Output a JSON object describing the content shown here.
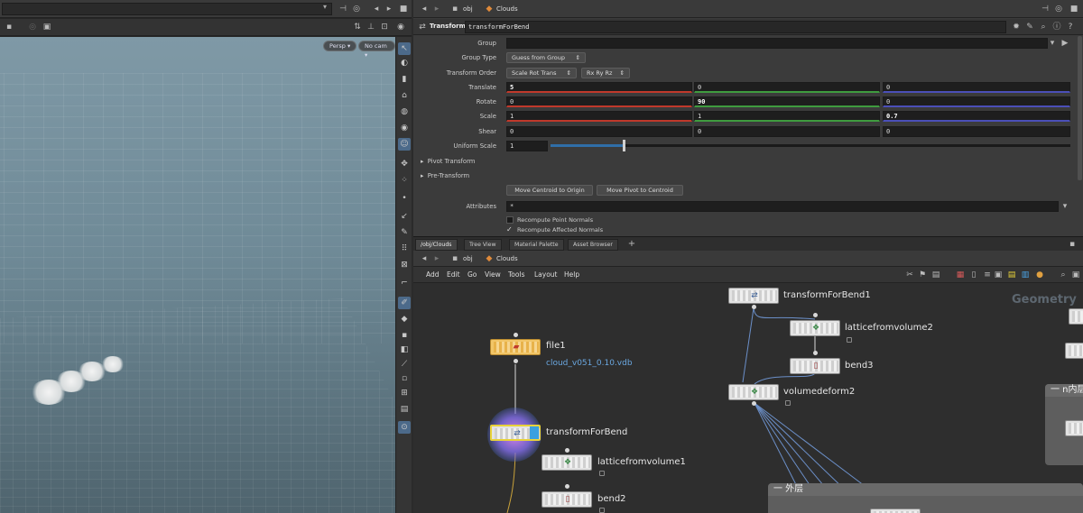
{
  "viewport": {
    "persp_label": "Persp",
    "camera_label": "No cam"
  },
  "params": {
    "path": {
      "obj": "obj",
      "network": "Clouds"
    },
    "node_type": "Transform",
    "node_name": "transformForBend",
    "rows": {
      "group": {
        "label": "Group",
        "value": ""
      },
      "group_type": {
        "label": "Group Type",
        "value": "Guess from Group"
      },
      "transform_order": {
        "label": "Transform Order",
        "value1": "Scale Rot Trans",
        "value2": "Rx Ry Rz"
      },
      "translate": {
        "label": "Translate",
        "x": "5",
        "y": "0",
        "z": "0"
      },
      "rotate": {
        "label": "Rotate",
        "x": "0",
        "y": "90",
        "z": "0"
      },
      "scale": {
        "label": "Scale",
        "x": "1",
        "y": "1",
        "z": "0.7"
      },
      "shear": {
        "label": "Shear",
        "x": "0",
        "y": "0",
        "z": "0"
      },
      "uniform_scale": {
        "label": "Uniform Scale",
        "value": "1",
        "slider_fraction": 0.14
      }
    },
    "folders": {
      "pivot": "Pivot Transform",
      "pre": "Pre-Transform"
    },
    "buttons": {
      "centroid_origin": "Move Centroid to Origin",
      "pivot_centroid": "Move Pivot to Centroid"
    },
    "attributes": {
      "label": "Attributes",
      "value": "*"
    },
    "checkboxes": {
      "recompute_normals": "Recompute Point Normals",
      "recompute_affected": "Recompute Affected Normals"
    }
  },
  "network": {
    "tabs": [
      "/obj/Clouds",
      "Tree View",
      "Material Palette",
      "Asset Browser"
    ],
    "add_tab": "+",
    "path": {
      "obj": "obj",
      "network": "Clouds"
    },
    "menu": [
      "Add",
      "Edit",
      "Go",
      "View",
      "Tools",
      "Layout",
      "Help"
    ],
    "nodes": {
      "file1": {
        "name": "file1",
        "subtitle": "cloud_v051_0.10.vdb"
      },
      "transformForBend": {
        "name": "transformForBend"
      },
      "latticefromvolume1": {
        "name": "latticefromvolume1"
      },
      "bend2": {
        "name": "bend2"
      },
      "transformForBend1": {
        "name": "transformForBend1"
      },
      "latticefromvolume2": {
        "name": "latticefromvolume2"
      },
      "bend3": {
        "name": "bend3"
      },
      "volumedeform2": {
        "name": "volumedeform2"
      }
    },
    "boxes": {
      "outer": "一 外层",
      "inner": "一 n内层"
    },
    "geometry_label": "Geometry"
  }
}
